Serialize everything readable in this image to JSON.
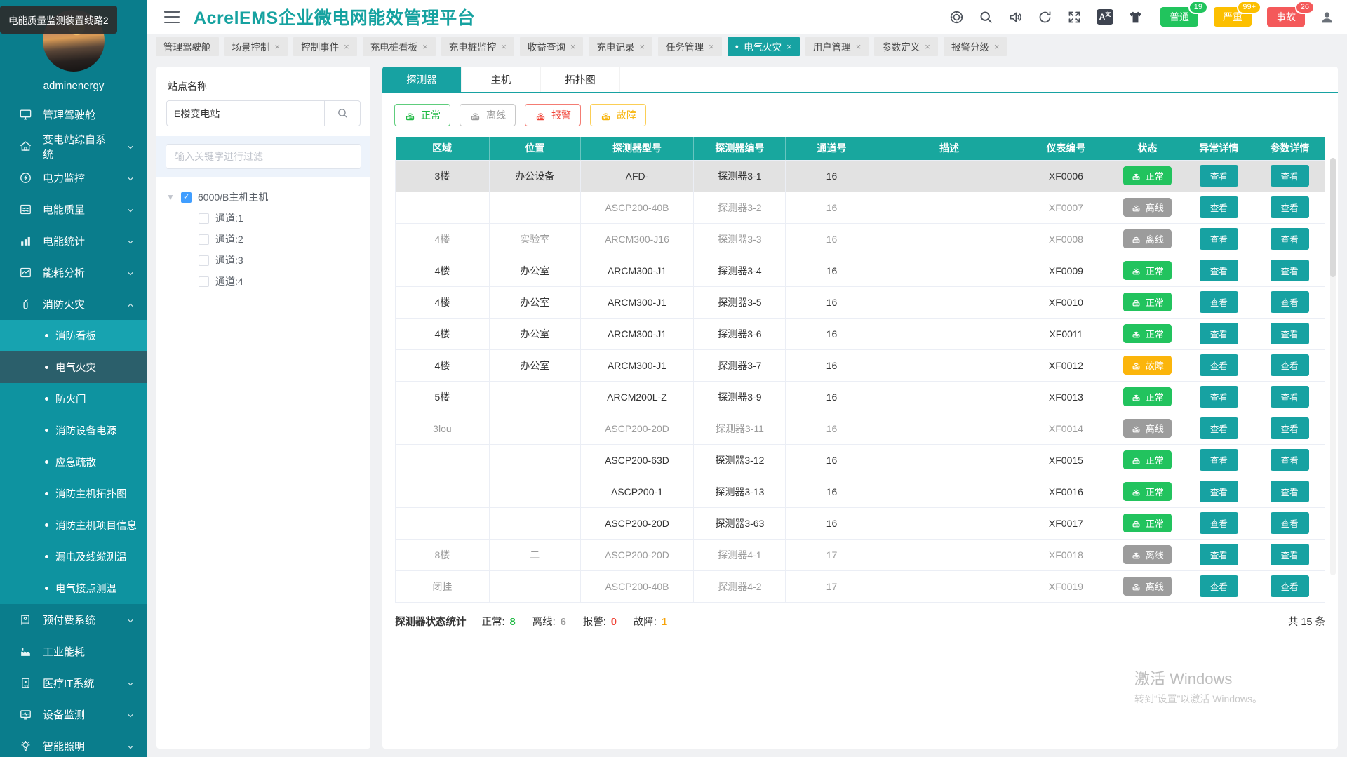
{
  "tooltip": "电能质量监测装置线路2",
  "colors": {
    "accent": "#17a2a2",
    "normal": "#22c35e",
    "offline": "#9c9c9c",
    "alarm": "#f04134",
    "fault": "#fbb50b"
  },
  "sidebar": {
    "username": "adminenergy",
    "items": [
      {
        "name": "dashboard",
        "icon": "monitor-icon",
        "label": "管理驾驶舱",
        "arrow": ""
      },
      {
        "name": "substation",
        "icon": "home-icon",
        "label": "变电站综自系统",
        "arrow": "down"
      },
      {
        "name": "power-monitor",
        "icon": "power-icon",
        "label": "电力监控",
        "arrow": "down"
      },
      {
        "name": "power-quality",
        "icon": "wave-chart-icon",
        "label": "电能质量",
        "arrow": "down"
      },
      {
        "name": "power-stats",
        "icon": "bar-chart-icon",
        "label": "电能统计",
        "arrow": "down"
      },
      {
        "name": "energy-analysis",
        "icon": "line-chart-icon",
        "label": "能耗分析",
        "arrow": "down"
      },
      {
        "name": "fire-safety",
        "icon": "extinguisher-icon",
        "label": "消防火灾",
        "arrow": "up",
        "expanded": true,
        "children": [
          {
            "label": "消防看板",
            "state": "hover"
          },
          {
            "label": "电气火灾",
            "state": "active"
          },
          {
            "label": "防火门",
            "state": ""
          },
          {
            "label": "消防设备电源",
            "state": ""
          },
          {
            "label": "应急疏散",
            "state": ""
          },
          {
            "label": "消防主机拓扑图",
            "state": ""
          },
          {
            "label": "消防主机项目信息",
            "state": ""
          },
          {
            "label": "漏电及线缆测温",
            "state": ""
          },
          {
            "label": "电气接点测温",
            "state": ""
          }
        ]
      },
      {
        "name": "prepaid",
        "icon": "book-icon",
        "label": "预付费系统",
        "arrow": "down"
      },
      {
        "name": "industrial-energy",
        "icon": "factory-icon",
        "label": "工业能耗",
        "arrow": ""
      },
      {
        "name": "medical-it",
        "icon": "hospital-icon",
        "label": "医疗IT系统",
        "arrow": "down"
      },
      {
        "name": "device-monitor",
        "icon": "screen-icon",
        "label": "设备监测",
        "arrow": "down"
      },
      {
        "name": "smart-lighting",
        "icon": "bulb-icon",
        "label": "智能照明",
        "arrow": "down"
      }
    ]
  },
  "header": {
    "title": "AcrelEMS企业微电网能效管理平台",
    "badges": [
      {
        "label": "普通",
        "count": "19",
        "type": "green"
      },
      {
        "label": "严重",
        "count": "99+",
        "type": "yellow"
      },
      {
        "label": "事故",
        "count": "26",
        "type": "red"
      }
    ]
  },
  "tabbar": [
    {
      "label": "管理驾驶舱",
      "closable": false,
      "active": false
    },
    {
      "label": "场景控制",
      "closable": true,
      "active": false
    },
    {
      "label": "控制事件",
      "closable": true,
      "active": false
    },
    {
      "label": "充电桩看板",
      "closable": true,
      "active": false
    },
    {
      "label": "充电桩监控",
      "closable": true,
      "active": false
    },
    {
      "label": "收益查询",
      "closable": true,
      "active": false
    },
    {
      "label": "充电记录",
      "closable": true,
      "active": false
    },
    {
      "label": "任务管理",
      "closable": true,
      "active": false
    },
    {
      "label": "电气火灾",
      "closable": true,
      "active": true
    },
    {
      "label": "用户管理",
      "closable": true,
      "active": false
    },
    {
      "label": "参数定义",
      "closable": true,
      "active": false
    },
    {
      "label": "报警分级",
      "closable": true,
      "active": false
    }
  ],
  "site_panel": {
    "title": "站点名称",
    "search_value": "E楼变电站",
    "filter_placeholder": "输入关键字进行过滤",
    "tree_root": "6000/B主机主机",
    "tree_children": [
      "通道:1",
      "通道:2",
      "通道:3",
      "通道:4"
    ]
  },
  "main": {
    "tabs": [
      {
        "label": "探测器",
        "active": true
      },
      {
        "label": "主机",
        "active": false
      },
      {
        "label": "拓扑图",
        "active": false
      }
    ],
    "filters": [
      {
        "label": "正常",
        "type": "green"
      },
      {
        "label": "离线",
        "type": "gray"
      },
      {
        "label": "报警",
        "type": "red"
      },
      {
        "label": "故障",
        "type": "yellow"
      }
    ],
    "table": {
      "columns": [
        "区域",
        "位置",
        "探测器型号",
        "探测器编号",
        "通道号",
        "描述",
        "仪表编号",
        "状态",
        "异常详情",
        "参数详情"
      ],
      "view_label": "查看",
      "status_labels": {
        "normal": "正常",
        "offline": "离线",
        "fault": "故障"
      },
      "rows": [
        {
          "area": "3楼",
          "location": "办公设备",
          "model": "AFD-",
          "code": "探测器3-1",
          "channel": "16",
          "desc": "",
          "meter": "XF0006",
          "status": "normal",
          "selected": true
        },
        {
          "area": "",
          "location": "",
          "model": "ASCP200-40B",
          "code": "探测器3-2",
          "channel": "16",
          "desc": "",
          "meter": "XF0007",
          "status": "offline",
          "selected": false
        },
        {
          "area": "4楼",
          "location": "实验室",
          "model": "ARCM300-J16",
          "code": "探测器3-3",
          "channel": "16",
          "desc": "",
          "meter": "XF0008",
          "status": "offline",
          "selected": false
        },
        {
          "area": "4楼",
          "location": "办公室",
          "model": "ARCM300-J1",
          "code": "探测器3-4",
          "channel": "16",
          "desc": "",
          "meter": "XF0009",
          "status": "normal",
          "selected": false
        },
        {
          "area": "4楼",
          "location": "办公室",
          "model": "ARCM300-J1",
          "code": "探测器3-5",
          "channel": "16",
          "desc": "",
          "meter": "XF0010",
          "status": "normal",
          "selected": false
        },
        {
          "area": "4楼",
          "location": "办公室",
          "model": "ARCM300-J1",
          "code": "探测器3-6",
          "channel": "16",
          "desc": "",
          "meter": "XF0011",
          "status": "normal",
          "selected": false
        },
        {
          "area": "4楼",
          "location": "办公室",
          "model": "ARCM300-J1",
          "code": "探测器3-7",
          "channel": "16",
          "desc": "",
          "meter": "XF0012",
          "status": "fault",
          "selected": false
        },
        {
          "area": "5楼",
          "location": "",
          "model": "ARCM200L-Z",
          "code": "探测器3-9",
          "channel": "16",
          "desc": "",
          "meter": "XF0013",
          "status": "normal",
          "selected": false
        },
        {
          "area": "3lou",
          "location": "",
          "model": "ASCP200-20D",
          "code": "探测器3-11",
          "channel": "16",
          "desc": "",
          "meter": "XF0014",
          "status": "offline",
          "selected": false
        },
        {
          "area": "",
          "location": "",
          "model": "ASCP200-63D",
          "code": "探测器3-12",
          "channel": "16",
          "desc": "",
          "meter": "XF0015",
          "status": "normal",
          "selected": false
        },
        {
          "area": "",
          "location": "",
          "model": "ASCP200-1",
          "code": "探测器3-13",
          "channel": "16",
          "desc": "",
          "meter": "XF0016",
          "status": "normal",
          "selected": false
        },
        {
          "area": "",
          "location": "",
          "model": "ASCP200-20D",
          "code": "探测器3-63",
          "channel": "16",
          "desc": "",
          "meter": "XF0017",
          "status": "normal",
          "selected": false
        },
        {
          "area": "8楼",
          "location": "二",
          "model": "ASCP200-20D",
          "code": "探测器4-1",
          "channel": "17",
          "desc": "",
          "meter": "XF0018",
          "status": "offline",
          "selected": false
        },
        {
          "area": "闭挂",
          "location": "",
          "model": "ASCP200-40B",
          "code": "探测器4-2",
          "channel": "17",
          "desc": "",
          "meter": "XF0019",
          "status": "offline",
          "selected": false
        }
      ]
    },
    "summary": {
      "title": "探测器状态统计",
      "items": [
        {
          "label": "正常",
          "value": "8",
          "type": "green"
        },
        {
          "label": "离线",
          "value": "6",
          "type": "gray"
        },
        {
          "label": "报警",
          "value": "0",
          "type": "red"
        },
        {
          "label": "故障",
          "value": "1",
          "type": "yellow"
        }
      ],
      "total": "共 15 条"
    }
  },
  "watermark": {
    "line1": "激活 Windows",
    "line2": "转到“设置”以激活 Windows。"
  }
}
